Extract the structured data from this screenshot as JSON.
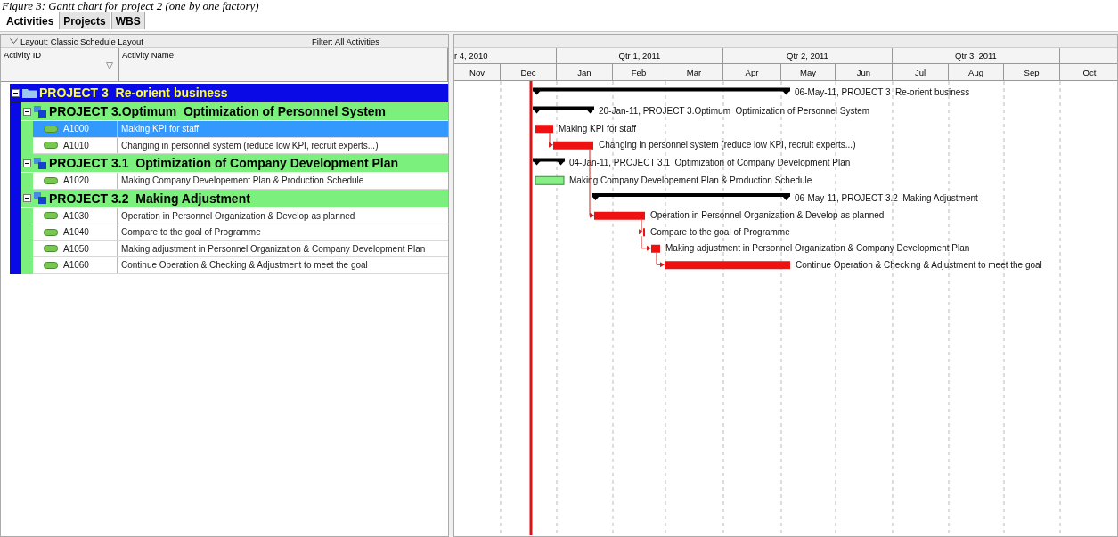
{
  "caption": "Figure 3: Gantt chart for project 2 (one by one factory)",
  "tabs": [
    {
      "label": "Activities",
      "selected": true
    },
    {
      "label": "Projects",
      "selected": false
    },
    {
      "label": "WBS",
      "selected": false
    }
  ],
  "layout_bar": {
    "layout": "Layout: Classic Schedule Layout",
    "filter": "Filter: All Activities"
  },
  "table": {
    "columns": [
      "Activity ID",
      "Activity Name"
    ],
    "rows": [
      {
        "kind": "project",
        "name": "PROJECT 3  Re-orient business",
        "expanded": true,
        "children": [
          {
            "kind": "wbs",
            "name": "PROJECT 3.Optimum  Optimization of Personnel System",
            "expanded": true,
            "children": [
              {
                "kind": "activity",
                "id": "A1000",
                "name": "Making KPI for staff",
                "selected": true
              },
              {
                "kind": "activity",
                "id": "A1010",
                "name": "Changing in personnel system (reduce low KPI, recruit experts...)",
                "selected": false
              }
            ]
          },
          {
            "kind": "wbs",
            "name": "PROJECT 3.1  Optimization of Company Development Plan",
            "expanded": true,
            "children": [
              {
                "kind": "activity",
                "id": "A1020",
                "name": "Making Company Developement Plan & Production Schedule",
                "selected": false
              }
            ]
          },
          {
            "kind": "wbs",
            "name": "PROJECT 3.2  Making Adjustment",
            "expanded": true,
            "children": [
              {
                "kind": "activity",
                "id": "A1030",
                "name": "Operation in Personnel Organization & Develop as planned",
                "selected": false
              },
              {
                "kind": "activity",
                "id": "A1040",
                "name": "Compare to the goal of Programme",
                "selected": false
              },
              {
                "kind": "activity",
                "id": "A1050",
                "name": "Making adjustment in Personnel Organization & Company Development Plan",
                "selected": false
              },
              {
                "kind": "activity",
                "id": "A1060",
                "name": "Continue Operation & Checking & Adjustment to meet the goal",
                "selected": false
              }
            ]
          }
        ]
      }
    ]
  },
  "gantt": {
    "quarters": [
      "r 4, 2010",
      "Qtr 1, 2011",
      "Qtr 2, 2011",
      "Qtr 3, 2011"
    ],
    "months": [
      "Nov",
      "Dec",
      "Jan",
      "Feb",
      "Mar",
      "Apr",
      "May",
      "Jun",
      "Jul",
      "Aug",
      "Sep",
      "Oct"
    ],
    "bars": [
      {
        "kind": "summary",
        "label": "06-May-11, PROJECT 3  Re-orient business"
      },
      {
        "kind": "summary",
        "label": "20-Jan-11, PROJECT 3.Optimum  Optimization of Personnel System"
      },
      {
        "kind": "critical",
        "label": "Making KPI for staff"
      },
      {
        "kind": "critical",
        "label": "Changing in personnel system (reduce low KPI, recruit experts...)"
      },
      {
        "kind": "summary",
        "label": "04-Jan-11, PROJECT 3.1  Optimization of Company Development Plan"
      },
      {
        "kind": "normal",
        "label": "Making Company Developement Plan & Production Schedule"
      },
      {
        "kind": "summary",
        "label": "06-May-11, PROJECT 3.2  Making Adjustment"
      },
      {
        "kind": "critical",
        "label": "Operation in Personnel Organization & Develop as planned"
      },
      {
        "kind": "critical",
        "label": "Compare to the goal of Programme"
      },
      {
        "kind": "critical",
        "label": "Making adjustment in Personnel Organization & Company Development Plan"
      },
      {
        "kind": "critical",
        "label": "Continue Operation & Checking & Adjustment to meet the goal"
      }
    ]
  }
}
